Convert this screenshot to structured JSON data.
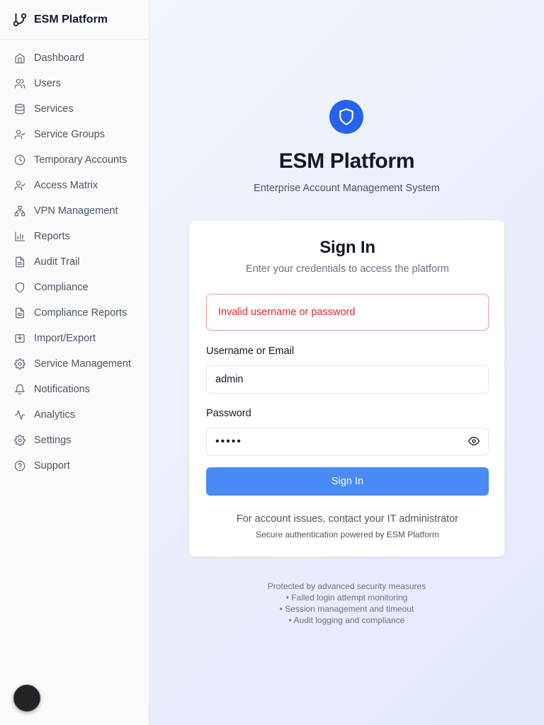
{
  "sidebar": {
    "brand": {
      "name": "ESM Platform",
      "icon": "git-branch-icon"
    },
    "items": [
      {
        "label": "Dashboard",
        "icon": "home-icon"
      },
      {
        "label": "Users",
        "icon": "users-icon"
      },
      {
        "label": "Services",
        "icon": "database-icon"
      },
      {
        "label": "Service Groups",
        "icon": "user-check-icon"
      },
      {
        "label": "Temporary Accounts",
        "icon": "clock-icon"
      },
      {
        "label": "Access Matrix",
        "icon": "user-check-icon"
      },
      {
        "label": "VPN Management",
        "icon": "network-icon"
      },
      {
        "label": "Reports",
        "icon": "bar-chart-icon"
      },
      {
        "label": "Audit Trail",
        "icon": "file-text-icon"
      },
      {
        "label": "Compliance",
        "icon": "shield-icon"
      },
      {
        "label": "Compliance Reports",
        "icon": "file-text-icon"
      },
      {
        "label": "Import/Export",
        "icon": "import-icon"
      },
      {
        "label": "Service Management",
        "icon": "gear-icon"
      },
      {
        "label": "Notifications",
        "icon": "bell-icon"
      },
      {
        "label": "Analytics",
        "icon": "activity-icon"
      },
      {
        "label": "Settings",
        "icon": "gear-icon"
      },
      {
        "label": "Support",
        "icon": "help-circle-icon"
      }
    ]
  },
  "main": {
    "logo_icon": "shield-icon",
    "title": "ESM Platform",
    "subtitle": "Enterprise Account Management System",
    "login": {
      "title": "Sign In",
      "description": "Enter your credentials to access the platform",
      "error": "Invalid username or password",
      "username_label": "Username or Email",
      "username_value": "admin",
      "password_label": "Password",
      "password_value": "admin",
      "submit_label": "Sign In",
      "help": "For account issues, contact your IT administrator",
      "powered_by": "Secure authentication powered by ESM Platform"
    },
    "security": {
      "heading": "Protected by advanced security measures",
      "items": [
        "• Failed login attempt monitoring",
        "• Session management and timeout",
        "• Audit logging and compliance"
      ]
    }
  },
  "colors": {
    "accent": "#2563eb",
    "button": "#4a8af4",
    "error_text": "#dc2626",
    "error_border": "#f0a08c"
  }
}
